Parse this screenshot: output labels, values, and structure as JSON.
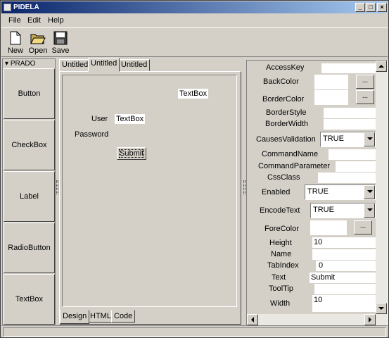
{
  "window": {
    "title": "PIDELA"
  },
  "menu": [
    "File",
    "Edit",
    "Help"
  ],
  "toolbar": {
    "new_label": "New",
    "open_label": "Open",
    "save_label": "Save"
  },
  "palette": {
    "header": "PRADO",
    "items": [
      "Button",
      "CheckBox",
      "Label",
      "RadioButton",
      "TextBox"
    ]
  },
  "editor": {
    "tabs": [
      "Untitled",
      "Untitled",
      "Untitled"
    ],
    "bottom_tabs": [
      "Design",
      "HTML",
      "Code"
    ],
    "controls": {
      "textbox_top": "TextBox",
      "user_label": "User",
      "user_textbox": "TextBox",
      "password_label": "Password",
      "submit_button": "Submit"
    }
  },
  "properties": {
    "rows": [
      {
        "name": "AccessKey",
        "value": ""
      },
      {
        "name": "BackColor",
        "value": "",
        "button": "..."
      },
      {
        "name": "BorderColor",
        "value": "",
        "button": "..."
      },
      {
        "name": "BorderStyle",
        "value": ""
      },
      {
        "name": "BorderWidth",
        "value": ""
      },
      {
        "name": "CausesValidation",
        "value": "TRUE"
      },
      {
        "name": "CommandName",
        "value": ""
      },
      {
        "name": "CommandParameter",
        "value": ""
      },
      {
        "name": "CssClass",
        "value": ""
      },
      {
        "name": "Enabled",
        "value": "TRUE"
      },
      {
        "name": "EncodeText",
        "value": "TRUE"
      },
      {
        "name": "ForeColor",
        "value": "",
        "button": "..."
      },
      {
        "name": "Height",
        "value": "10"
      },
      {
        "name": "Name",
        "value": ""
      },
      {
        "name": "TabIndex",
        "value": "0"
      },
      {
        "name": "Text",
        "value": "Submit"
      },
      {
        "name": "ToolTip",
        "value": ""
      },
      {
        "name": "Width",
        "value": "10"
      }
    ]
  }
}
